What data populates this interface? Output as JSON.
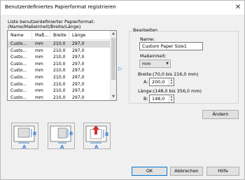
{
  "window": {
    "title": "Benutzerdefiniertes Papierformat registrieren",
    "close_glyph": "✕"
  },
  "list": {
    "label_line1": "Liste benutzerdefinierter Papierformat:",
    "label_line2": "(Name/Maßeinheit/Breite/Länge)",
    "columns": [
      "Name",
      "Maß...",
      "Breite",
      "Länge"
    ],
    "rows": [
      [
        "Custo...",
        "mm",
        "210,0",
        "297,0"
      ],
      [
        "Custo...",
        "mm",
        "210,0",
        "297,0"
      ],
      [
        "Custo...",
        "mm",
        "210,0",
        "297,0"
      ],
      [
        "Custo...",
        "mm",
        "210,0",
        "297,0"
      ],
      [
        "Custo...",
        "mm",
        "210,0",
        "297,0"
      ],
      [
        "Custo...",
        "mm",
        "210,0",
        "297,0"
      ],
      [
        "Custo...",
        "mm",
        "210,0",
        "297,0"
      ],
      [
        "Custo...",
        "mm",
        "210,0",
        "297,0"
      ],
      [
        "Custo...",
        "mm",
        "210,0",
        "297,0"
      ]
    ],
    "selected_row": 0
  },
  "edit": {
    "group_title": "Bearbeiten",
    "name_label": "Name:",
    "name_value": "Custom Paper Size1",
    "unit_label": "Maßeinheit:",
    "unit_value": "mm",
    "width_label": "Breite:(70,0 bis 216,0 mm)",
    "width_prefix": "A:",
    "width_value": "200,0",
    "length_label": "Länge:(148,0 bis 356,0 mm)",
    "length_prefix": "B:",
    "length_value": "148,0"
  },
  "buttons": {
    "change": "Ändern",
    "ok": "OK",
    "cancel": "Abbrechen",
    "help": "Hilfe"
  },
  "illustrations": {
    "label_a": "A",
    "label_b": "B"
  },
  "colors": {
    "accent_blue": "#3c7fd7",
    "red_arrow": "#d32f2f",
    "selected_row": "#d9d9d9"
  }
}
